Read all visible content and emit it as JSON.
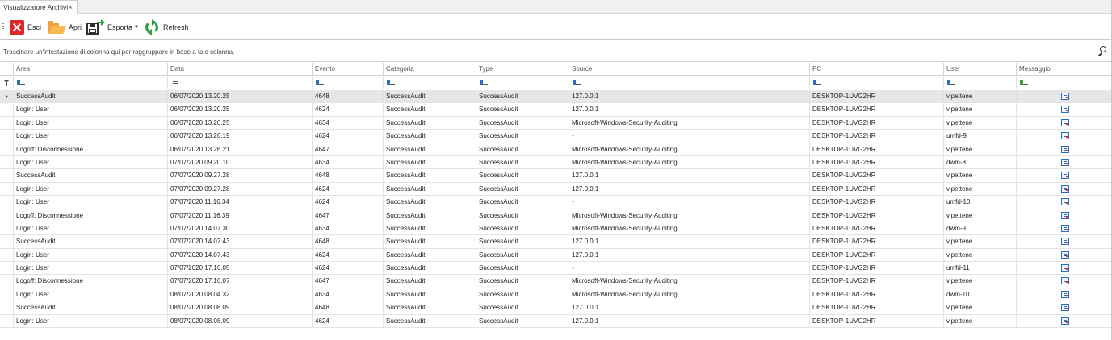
{
  "tab": {
    "title": "Visualizzatore Archivi",
    "close_glyph": "×"
  },
  "toolbar": {
    "exit_label": "Esci",
    "open_label": "Apri",
    "export_label": "Esporta",
    "refresh_label": "Refresh"
  },
  "group_panel": {
    "hint": "Trascinare un'intestazione di colonna qui per raggruppare in base a tale colonna."
  },
  "columns": [
    "Area",
    "Data",
    "Evento",
    "Categoria",
    "Type",
    "Source",
    "PC",
    "User",
    "Messaggio"
  ],
  "rows": [
    [
      "SuccessAudit",
      "06/07/2020 13.20.25",
      "4648",
      "SuccessAudit",
      "SuccessAudit",
      "127.0.0.1",
      "DESKTOP-1UVG2HR",
      "v.pettene"
    ],
    [
      "Login: User",
      "06/07/2020 13.20.25",
      "4624",
      "SuccessAudit",
      "SuccessAudit",
      "127.0.0.1",
      "DESKTOP-1UVG2HR",
      "v.pettene"
    ],
    [
      "Login: User",
      "06/07/2020 13.20.25",
      "4634",
      "SuccessAudit",
      "SuccessAudit",
      "Microsoft-Windows-Security-Auditing",
      "DESKTOP-1UVG2HR",
      "v.pettene"
    ],
    [
      "Login: User",
      "06/07/2020 13.26.19",
      "4624",
      "SuccessAudit",
      "SuccessAudit",
      "-",
      "DESKTOP-1UVG2HR",
      "umfd-9"
    ],
    [
      "Logoff: Disconnessione",
      "06/07/2020 13.26.21",
      "4647",
      "SuccessAudit",
      "SuccessAudit",
      "Microsoft-Windows-Security-Auditing",
      "DESKTOP-1UVG2HR",
      "v.pettene"
    ],
    [
      "Login: User",
      "07/07/2020 09.20.10",
      "4634",
      "SuccessAudit",
      "SuccessAudit",
      "Microsoft-Windows-Security-Auditing",
      "DESKTOP-1UVG2HR",
      "dwm-8"
    ],
    [
      "SuccessAudit",
      "07/07/2020 09.27.28",
      "4648",
      "SuccessAudit",
      "SuccessAudit",
      "127.0.0.1",
      "DESKTOP-1UVG2HR",
      "v.pettene"
    ],
    [
      "Login: User",
      "07/07/2020 09.27.28",
      "4624",
      "SuccessAudit",
      "SuccessAudit",
      "127.0.0.1",
      "DESKTOP-1UVG2HR",
      "v.pettene"
    ],
    [
      "Login: User",
      "07/07/2020 11.16.34",
      "4624",
      "SuccessAudit",
      "SuccessAudit",
      "-",
      "DESKTOP-1UVG2HR",
      "umfd-10"
    ],
    [
      "Logoff: Disconnessione",
      "07/07/2020 11.16.39",
      "4647",
      "SuccessAudit",
      "SuccessAudit",
      "Microsoft-Windows-Security-Auditing",
      "DESKTOP-1UVG2HR",
      "v.pettene"
    ],
    [
      "Login: User",
      "07/07/2020 14.07.30",
      "4634",
      "SuccessAudit",
      "SuccessAudit",
      "Microsoft-Windows-Security-Auditing",
      "DESKTOP-1UVG2HR",
      "dwm-9"
    ],
    [
      "SuccessAudit",
      "07/07/2020 14.07.43",
      "4648",
      "SuccessAudit",
      "SuccessAudit",
      "127.0.0.1",
      "DESKTOP-1UVG2HR",
      "v.pettene"
    ],
    [
      "Login: User",
      "07/07/2020 14.07.43",
      "4624",
      "SuccessAudit",
      "SuccessAudit",
      "127.0.0.1",
      "DESKTOP-1UVG2HR",
      "v.pettene"
    ],
    [
      "Login: User",
      "07/07/2020 17.16.05",
      "4624",
      "SuccessAudit",
      "SuccessAudit",
      "-",
      "DESKTOP-1UVG2HR",
      "umfd-11"
    ],
    [
      "Logoff: Disconnessione",
      "07/07/2020 17.16.07",
      "4647",
      "SuccessAudit",
      "SuccessAudit",
      "Microsoft-Windows-Security-Auditing",
      "DESKTOP-1UVG2HR",
      "v.pettene"
    ],
    [
      "Login: User",
      "08/07/2020 08.04.32",
      "4634",
      "SuccessAudit",
      "SuccessAudit",
      "Microsoft-Windows-Security-Auditing",
      "DESKTOP-1UVG2HR",
      "dwm-10"
    ],
    [
      "SuccessAudit",
      "08/07/2020 08.08.09",
      "4648",
      "SuccessAudit",
      "SuccessAudit",
      "127.0.0.1",
      "DESKTOP-1UVG2HR",
      "v.pettene"
    ],
    [
      "Login: User",
      "08/07/2020 08.08.09",
      "4624",
      "SuccessAudit",
      "SuccessAudit",
      "127.0.0.1",
      "DESKTOP-1UVG2HR",
      "v.pettene"
    ]
  ],
  "selected_row": 0,
  "filter_icons": [
    "abc-filter-icon",
    "equals-filter-icon",
    "abc-filter-icon",
    "abc-filter-icon",
    "abc-filter-icon",
    "abc-filter-icon",
    "abc-filter-icon",
    "abc-filter-icon",
    "abc-filter-icon"
  ],
  "colors": {
    "selected_row": "#e6e6e6",
    "exit_red": "#e0262b",
    "refresh_green": "#2e9d3a",
    "folder_orange": "#f2a03a"
  }
}
